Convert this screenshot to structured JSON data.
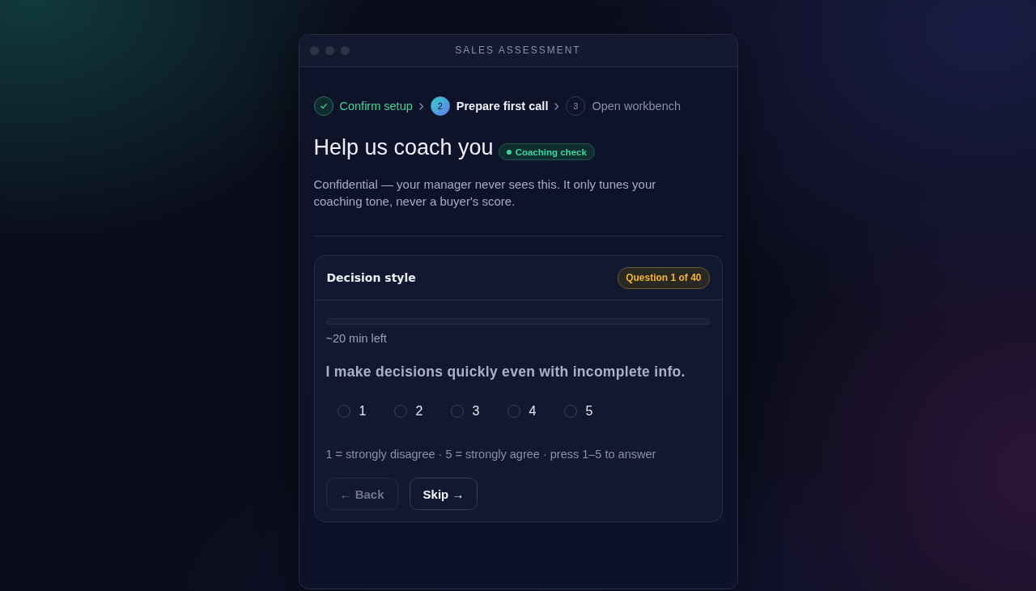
{
  "window": {
    "title": "SALES ASSESSMENT"
  },
  "stepper": [
    {
      "label": "Confirm setup",
      "done": true,
      "selected": false
    },
    {
      "number": "2",
      "label": "Prepare first call",
      "done": false,
      "selected": true
    },
    {
      "number": "3",
      "label": "Open workbench",
      "done": false,
      "selected": false
    }
  ],
  "header": {
    "title": "Help us coach you",
    "badge": "Coaching check",
    "description": "Confidential — your manager never sees this. It only tunes your coaching tone, never a buyer's score."
  },
  "question_card": {
    "section": "Decision style",
    "counter": "Question 1 of 40",
    "progress": {
      "level": 0
    },
    "time_left": "~20 min left",
    "question": "I make decisions quickly even with incomplete info.",
    "options": [
      {
        "label": "1",
        "selected": false
      },
      {
        "label": "2",
        "selected": false
      },
      {
        "label": "3",
        "selected": false
      },
      {
        "label": "4",
        "selected": false
      },
      {
        "label": "5",
        "selected": false
      }
    ],
    "hint": "1 = strongly disagree · 5 = strongly agree · press 1–5 to answer",
    "buttons": [
      {
        "label": "← Back",
        "disabled": true
      },
      {
        "label": "Skip →",
        "disabled": false
      }
    ]
  }
}
